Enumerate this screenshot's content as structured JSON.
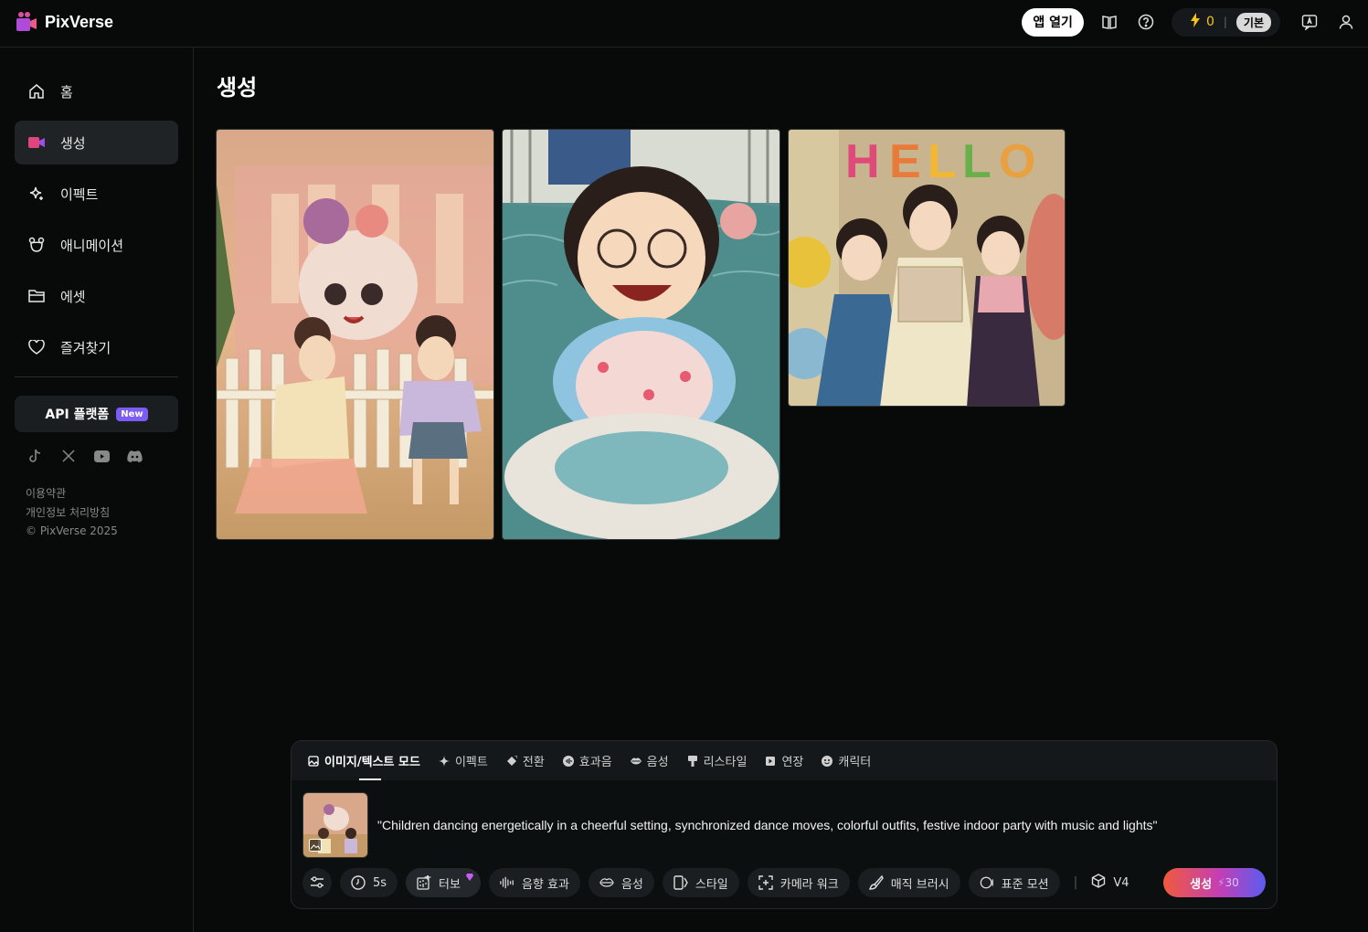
{
  "app": {
    "name": "PixVerse"
  },
  "topbar": {
    "open_app_label": "앱 열기",
    "credits": "0",
    "plan": "기본",
    "icons": [
      "book-icon",
      "help-icon",
      "bolt-icon",
      "translate-icon",
      "user-icon"
    ]
  },
  "sidebar": {
    "items": [
      {
        "label": "홈",
        "icon": "home-icon",
        "active": false
      },
      {
        "label": "생성",
        "icon": "camera-icon",
        "active": true
      },
      {
        "label": "이펙트",
        "icon": "sparkle-icon",
        "active": false
      },
      {
        "label": "애니메이션",
        "icon": "mask-icon",
        "active": false
      },
      {
        "label": "에셋",
        "icon": "folder-icon",
        "active": false
      },
      {
        "label": "즐겨찾기",
        "icon": "heart-icon",
        "active": false
      }
    ],
    "api_label": "API 플랫폼",
    "api_badge": "New",
    "socials": [
      "tiktok-icon",
      "x-icon",
      "youtube-icon",
      "discord-icon"
    ],
    "footer": {
      "terms": "이용약관",
      "privacy": "개인정보 처리방침",
      "copyright": "© PixVerse 2025"
    }
  },
  "main": {
    "title": "생성",
    "gallery": [
      "children-mascot-image",
      "girl-pool-image",
      "girls-party-image"
    ]
  },
  "composer": {
    "tabs": [
      {
        "label": "이미지/텍스트 모드",
        "icon": "image-icon",
        "active": true
      },
      {
        "label": "이펙트",
        "icon": "sparkle-icon",
        "active": false
      },
      {
        "label": "전환",
        "icon": "transition-icon",
        "active": false
      },
      {
        "label": "효과음",
        "icon": "sound-icon",
        "active": false
      },
      {
        "label": "음성",
        "icon": "lips-icon",
        "active": false
      },
      {
        "label": "리스타일",
        "icon": "brush-icon",
        "active": false
      },
      {
        "label": "연장",
        "icon": "extend-icon",
        "active": false
      },
      {
        "label": "캐릭터",
        "icon": "character-icon",
        "active": false
      }
    ],
    "prompt": "\"Children dancing energetically in a cheerful setting, synchronized dance moves, colorful outfits, festive indoor party with music and lights\"",
    "toolbar": {
      "duration": "5s",
      "turbo": "터보",
      "sfx": "음향 효과",
      "voice": "음성",
      "style": "스타일",
      "camera": "카메라 워크",
      "brush": "매직 브러시",
      "motion": "표준 모션",
      "model": "V4",
      "generate_label": "생성",
      "generate_cost": "30"
    }
  },
  "colors": {
    "accent_gradient": [
      "#f05a3c",
      "#c33fb4",
      "#5b5cf0"
    ],
    "credit": "#f5c518",
    "badge": "#7b5cf5"
  }
}
